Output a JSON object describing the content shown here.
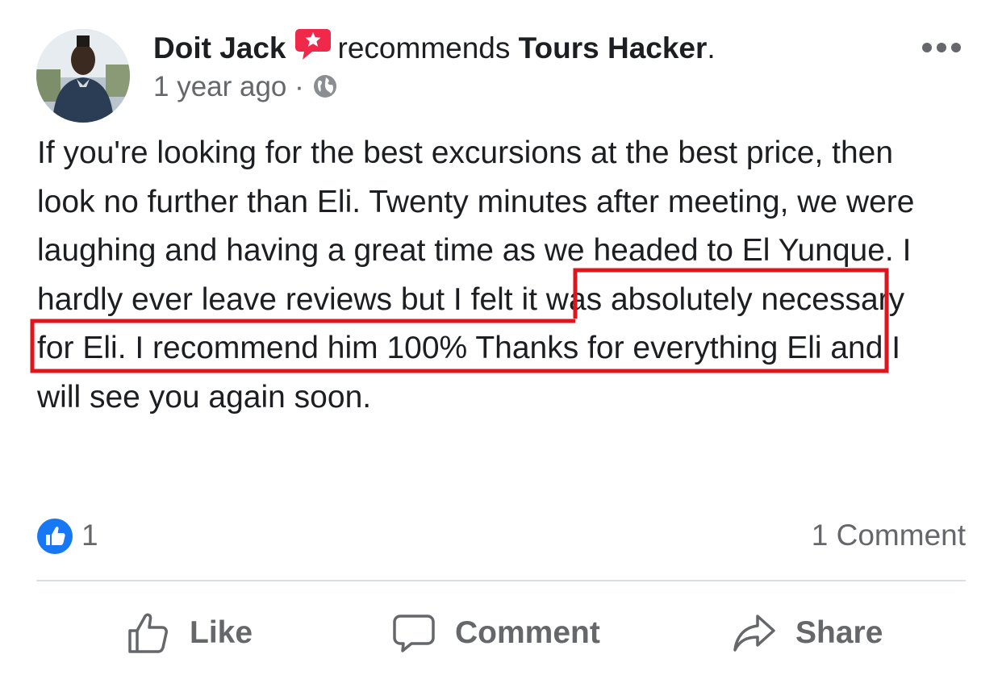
{
  "post": {
    "author": "Doit Jack",
    "recommends_text": "recommends",
    "page_name": "Tours Hacker",
    "page_name_suffix": ".",
    "timestamp": "1 year ago",
    "separator": "·",
    "privacy_icon": "globe-icon",
    "more_icon": "more-options-icon",
    "body_before": "If you're looking for the best excursions at the best price, then look no further than Eli. Twenty minutes after meeting, we were laughing and having a great time as we headed to El Yunque.",
    "body_highlight": " I hardly ever leave reviews but I felt it was absolutely necessary for Eli.",
    "body_after": " I recommend him 100%  Thanks for everything Eli and I will see you again soon."
  },
  "engagement": {
    "like_count": "1",
    "comments": "1 Comment"
  },
  "actions": {
    "like_label": "Like",
    "comment_label": "Comment",
    "share_label": "Share"
  },
  "colors": {
    "recommend_icon": "#f02849",
    "like_badge": "#1877f2",
    "highlight_box": "#e0141a",
    "secondary_text": "#65676b"
  }
}
